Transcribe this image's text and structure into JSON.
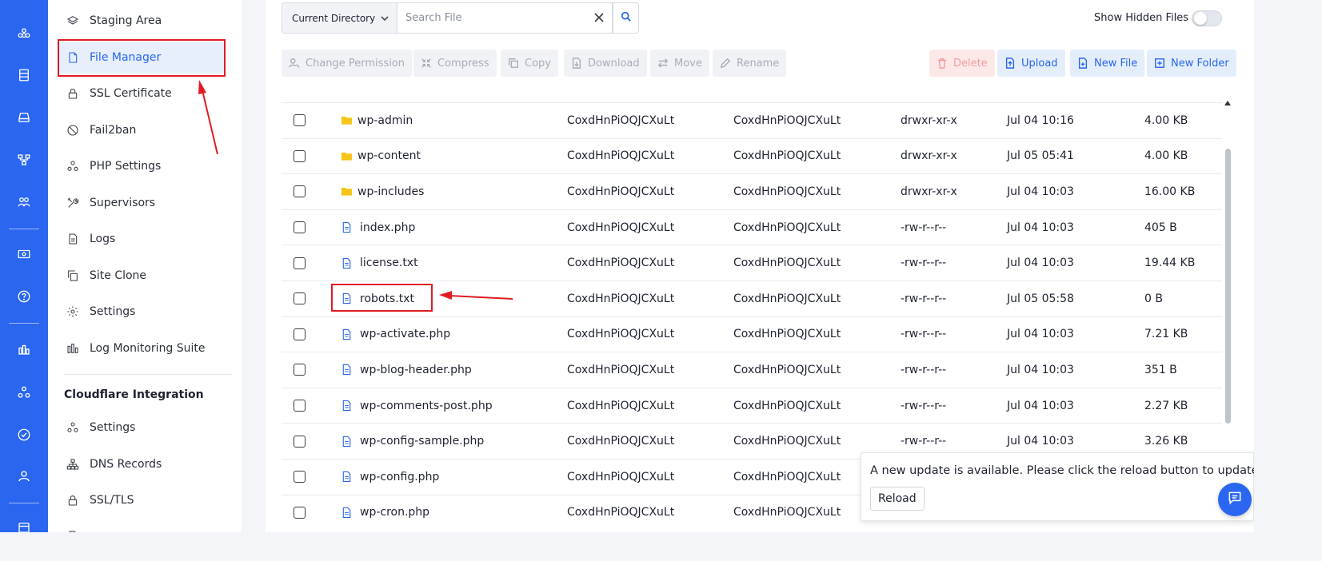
{
  "rail": {
    "icons": [
      "cluster-icon",
      "server-icon",
      "drive-icon",
      "network-icon",
      "team-icon",
      "billing-icon",
      "help-icon",
      "chart-icon",
      "nodes-icon",
      "check-icon",
      "support-icon",
      "calendar-icon"
    ]
  },
  "sidebar": {
    "items": [
      {
        "label": "Staging Area",
        "icon": "layers-icon"
      },
      {
        "label": "File Manager",
        "icon": "file-icon",
        "active": true
      },
      {
        "label": "SSL Certificate",
        "icon": "lock-icon"
      },
      {
        "label": "Fail2ban",
        "icon": "ban-icon"
      },
      {
        "label": "PHP Settings",
        "icon": "nodes-icon"
      },
      {
        "label": "Supervisors",
        "icon": "tools-icon"
      },
      {
        "label": "Logs",
        "icon": "document-icon"
      },
      {
        "label": "Site Clone",
        "icon": "copy-icon"
      },
      {
        "label": "Settings",
        "icon": "gear-icon"
      },
      {
        "label": "Log Monitoring Suite",
        "icon": "bar-chart-icon"
      }
    ],
    "section_title": "Cloudflare Integration",
    "cf_items": [
      {
        "label": "Settings",
        "icon": "nodes-icon"
      },
      {
        "label": "DNS Records",
        "icon": "sitemap-icon"
      },
      {
        "label": "SSL/TLS",
        "icon": "lock-icon"
      }
    ]
  },
  "toolbar": {
    "directory_select": "Current Directory",
    "search_placeholder": "Search File",
    "show_hidden_label": "Show Hidden Files",
    "show_hidden_on": false,
    "actions": {
      "change_permission": "Change Permission",
      "compress": "Compress",
      "copy": "Copy",
      "download": "Download",
      "move": "Move",
      "rename": "Rename",
      "delete": "Delete",
      "upload": "Upload",
      "new_file": "New File",
      "new_folder": "New Folder"
    }
  },
  "files": [
    {
      "name": "wp-admin",
      "type": "folder",
      "owner": "CoxdHnPiOQJCXuLt",
      "group": "CoxdHnPiOQJCXuLt",
      "perm": "drwxr-xr-x",
      "modified": "Jul 04 10:16",
      "size": "4.00 KB"
    },
    {
      "name": "wp-content",
      "type": "folder",
      "owner": "CoxdHnPiOQJCXuLt",
      "group": "CoxdHnPiOQJCXuLt",
      "perm": "drwxr-xr-x",
      "modified": "Jul 05 05:41",
      "size": "4.00 KB"
    },
    {
      "name": "wp-includes",
      "type": "folder",
      "owner": "CoxdHnPiOQJCXuLt",
      "group": "CoxdHnPiOQJCXuLt",
      "perm": "drwxr-xr-x",
      "modified": "Jul 04 10:03",
      "size": "16.00 KB"
    },
    {
      "name": "index.php",
      "type": "file",
      "owner": "CoxdHnPiOQJCXuLt",
      "group": "CoxdHnPiOQJCXuLt",
      "perm": "-rw-r--r--",
      "modified": "Jul 04 10:03",
      "size": "405 B"
    },
    {
      "name": "license.txt",
      "type": "file",
      "owner": "CoxdHnPiOQJCXuLt",
      "group": "CoxdHnPiOQJCXuLt",
      "perm": "-rw-r--r--",
      "modified": "Jul 04 10:03",
      "size": "19.44 KB"
    },
    {
      "name": "robots.txt",
      "type": "file",
      "owner": "CoxdHnPiOQJCXuLt",
      "group": "CoxdHnPiOQJCXuLt",
      "perm": "-rw-r--r--",
      "modified": "Jul 05 05:58",
      "size": "0 B"
    },
    {
      "name": "wp-activate.php",
      "type": "file",
      "owner": "CoxdHnPiOQJCXuLt",
      "group": "CoxdHnPiOQJCXuLt",
      "perm": "-rw-r--r--",
      "modified": "Jul 04 10:03",
      "size": "7.21 KB"
    },
    {
      "name": "wp-blog-header.php",
      "type": "file",
      "owner": "CoxdHnPiOQJCXuLt",
      "group": "CoxdHnPiOQJCXuLt",
      "perm": "-rw-r--r--",
      "modified": "Jul 04 10:03",
      "size": "351 B"
    },
    {
      "name": "wp-comments-post.php",
      "type": "file",
      "owner": "CoxdHnPiOQJCXuLt",
      "group": "CoxdHnPiOQJCXuLt",
      "perm": "-rw-r--r--",
      "modified": "Jul 04 10:03",
      "size": "2.27 KB"
    },
    {
      "name": "wp-config-sample.php",
      "type": "file",
      "owner": "CoxdHnPiOQJCXuLt",
      "group": "CoxdHnPiOQJCXuLt",
      "perm": "-rw-r--r--",
      "modified": "Jul 04 10:03",
      "size": "3.26 KB"
    },
    {
      "name": "wp-config.php",
      "type": "file",
      "owner": "CoxdHnPiOQJCXuLt",
      "group": "CoxdHnPiOQJCXuLt",
      "perm": "",
      "modified": "",
      "size": ""
    },
    {
      "name": "wp-cron.php",
      "type": "file",
      "owner": "CoxdHnPiOQJCXuLt",
      "group": "CoxdHnPiOQJCXuLt",
      "perm": "",
      "modified": "",
      "size": ""
    }
  ],
  "toast": {
    "message": "A new update is available. Please click the reload button to update.",
    "reload_label": "Reload"
  },
  "colors": {
    "brand": "#2a66f0",
    "highlight": "#e01b22",
    "folder": "#f5c518"
  }
}
